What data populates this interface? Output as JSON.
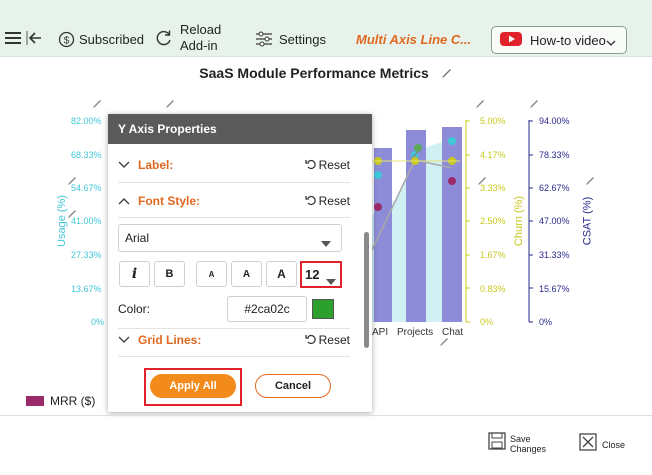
{
  "toolbar": {
    "subscribed_label": "Subscribed",
    "reload_label_1": "Reload",
    "reload_label_2": "Add-in",
    "settings_label": "Settings",
    "chart_name": "Multi Axis Line C...",
    "howto_label": "How-to video"
  },
  "chart": {
    "title": "SaaS Module Performance Metrics",
    "left_axis": {
      "title": "Usage (%)",
      "ticks": [
        "82.00%",
        "68.33%",
        "54.67%",
        "41.00%",
        "27.33%",
        "13.67%",
        "0%"
      ]
    },
    "churn_axis": {
      "title": "Churn (%)",
      "ticks": [
        "5.00%",
        "4.17%",
        "3.33%",
        "2.50%",
        "1.67%",
        "0.83%",
        "0%"
      ]
    },
    "csat_axis": {
      "title": "CSAT (%)",
      "ticks": [
        "94.00%",
        "78.33%",
        "62.67%",
        "47.00%",
        "31.33%",
        "15.67%",
        "0%"
      ]
    },
    "x_categories_visible": [
      "API",
      "Projects",
      "Chat"
    ],
    "legend_first": "MRR ($)"
  },
  "panel": {
    "header": "Y Axis Properties",
    "label_section": "Label:",
    "font_style_section": "Font Style:",
    "grid_lines_section": "Grid Lines:",
    "reset_label": "Reset",
    "font_family": "Arial",
    "btn_italic": "i",
    "btn_bold": "B",
    "btn_a_small": "A",
    "btn_a_mid": "A",
    "btn_a_large": "A",
    "font_size": "12",
    "color_label": "Color:",
    "color_value": "#2ca02c",
    "color_swatch": "#2ca02c",
    "apply_label": "Apply All",
    "cancel_label": "Cancel"
  },
  "footer": {
    "save_label_1": "Save",
    "save_label_2": "Changes",
    "close_label": "Close"
  },
  "colors": {
    "usage_axis": "#41c8d8",
    "churn_axis": "#c8c81e",
    "csat_axis": "#2a2a8c",
    "bar": "#8c8cd8",
    "accent": "#e06820",
    "highlight": "#e0222a"
  }
}
